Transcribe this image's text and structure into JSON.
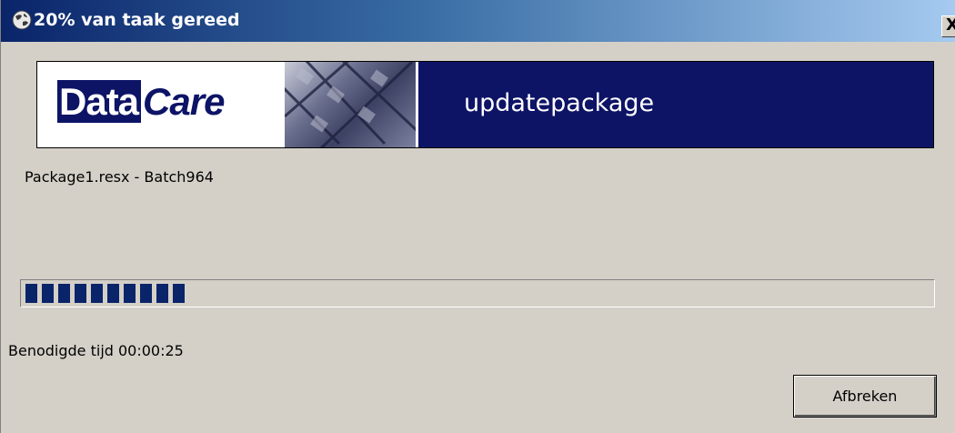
{
  "window": {
    "title": "20% van taak gereed",
    "close_label": "X"
  },
  "banner": {
    "logo_part1": "Data",
    "logo_part2": "Care",
    "title": "updatepackage",
    "brand_color": "#0d1466"
  },
  "task": {
    "package_text": "Package1.resx - Batch964",
    "progress_percent": 20,
    "elapsed_text": "Benodigde tijd 00:00:25"
  },
  "buttons": {
    "cancel_label": "Afbreken"
  }
}
